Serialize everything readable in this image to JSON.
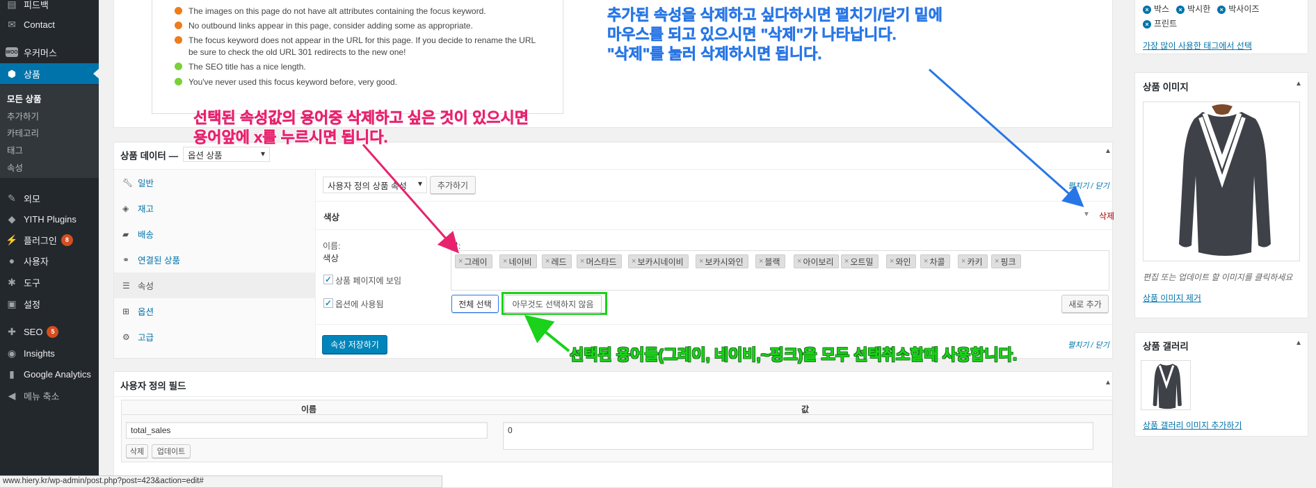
{
  "sidebar": {
    "items": [
      {
        "label": "피드백",
        "icon": "feedback-icon"
      },
      {
        "label": "Contact",
        "icon": "mail-icon"
      },
      {
        "label": "우커머스",
        "icon": "woo-icon",
        "icon_text": "WOO"
      },
      {
        "label": "상품",
        "icon": "box-icon"
      },
      {
        "label": "외모",
        "icon": "brush-icon"
      },
      {
        "label": "YITH Plugins",
        "icon": "yith-icon"
      },
      {
        "label": "플러그인",
        "icon": "plugin-icon",
        "badge": "8"
      },
      {
        "label": "사용자",
        "icon": "user-icon"
      },
      {
        "label": "도구",
        "icon": "wrench-icon"
      },
      {
        "label": "설정",
        "icon": "settings-icon"
      },
      {
        "label": "SEO",
        "icon": "seo-icon",
        "badge": "5"
      },
      {
        "label": "Insights",
        "icon": "insights-icon"
      },
      {
        "label": "Google Analytics",
        "icon": "analytics-icon"
      },
      {
        "label": "메뉴 축소",
        "icon": "collapse-icon"
      }
    ],
    "submenu": [
      "모든 상품",
      "추가하기",
      "카테고리",
      "태그",
      "속성"
    ]
  },
  "seo": {
    "items": [
      {
        "text": "The images on this page do not have alt attributes containing the focus keyword.",
        "color": "#ee7c1b"
      },
      {
        "text": "No outbound links appear in this page, consider adding some as appropriate.",
        "color": "#ee7c1b"
      },
      {
        "text": "The focus keyword does not appear in the URL for this page. If you decide to rename the URL",
        "text2": "be sure to check the old URL 301 redirects to the new one!",
        "color": "#ee7c1b"
      },
      {
        "text": "The SEO title has a nice length.",
        "color": "#7ad03a"
      },
      {
        "text": "You've never used this focus keyword before, very good.",
        "color": "#7ad03a"
      }
    ]
  },
  "product_data": {
    "title": "상품 데이터 —",
    "type_select": "옵션 상품",
    "tabs": [
      {
        "label": "일반",
        "icon": "wrench-icon"
      },
      {
        "label": "재고",
        "icon": "tag-icon"
      },
      {
        "label": "배송",
        "icon": "truck-icon"
      },
      {
        "label": "연결된 상품",
        "icon": "link-icon"
      },
      {
        "label": "속성",
        "icon": "list-icon"
      },
      {
        "label": "옵션",
        "icon": "grid-icon"
      },
      {
        "label": "고급",
        "icon": "gear-icon"
      }
    ],
    "attr_select": "사용자 정의 상품 속성",
    "add_button": "추가하기",
    "expand_collapse": "펼치기 / 닫기",
    "attribute_name": "색상",
    "remove_label": "삭제",
    "name_label": "이름:",
    "name_value": "색상",
    "value_label": "값:",
    "terms": [
      "그레이",
      "네이비",
      "레드",
      "머스타드",
      "보카시네이비",
      "보카시와인",
      "블랙",
      "아이보리",
      "오트밀",
      "와인",
      "차콜",
      "카키",
      "핑크"
    ],
    "visible_on_page": "상품 페이지에 보임",
    "used_for_variations": "옵션에 사용됨",
    "select_all": "전체 선택",
    "select_none": "아무것도 선택하지 않음",
    "add_new": "새로 추가",
    "save_attributes": "속성 저장하기"
  },
  "custom_fields": {
    "title": "사용자 정의 필드",
    "col_name": "이름",
    "col_value": "값",
    "name_value": "total_sales",
    "value_value": "0",
    "delete_button": "삭제",
    "update_button": "업데이트"
  },
  "right": {
    "tags": [
      "박스",
      "박시한",
      "박사이즈",
      "프린트"
    ],
    "most_used_link": "가장 많이 사용한 태그에서 선택",
    "product_image_title": "상품 이미지",
    "image_hint": "편집 또는 업데이트 할 이미지를 클릭하세요",
    "remove_image": "상품 이미지 제거",
    "gallery_title": "상품 갤러리",
    "add_gallery": "상품 갤러리 이미지 추가하기"
  },
  "annotations": {
    "blue": [
      "추가된 속성을 삭제하고 싶다하시면 펼치기/닫기 밑에",
      "마우스를 되고 있으시면 \"삭제\"가 나타납니다.",
      "\"삭제\"를 눌러 삭제하시면 됩니다."
    ],
    "red": [
      "선택된 속성값의 용어중 삭제하고 싶은 것이 있으시면",
      "용어앞에 x를 누르시면 됩니다."
    ],
    "green": "선택된 용어들(그레이, 네이비,~핑크)을 모두 선택취소할때 사용합니다."
  },
  "status_url": "www.hiery.kr/wp-admin/post.php?post=423&action=edit#",
  "colors": {
    "accent": "#0073aa",
    "sidebar": "#23282d",
    "save": "#0085ba",
    "remove": "#a00"
  }
}
